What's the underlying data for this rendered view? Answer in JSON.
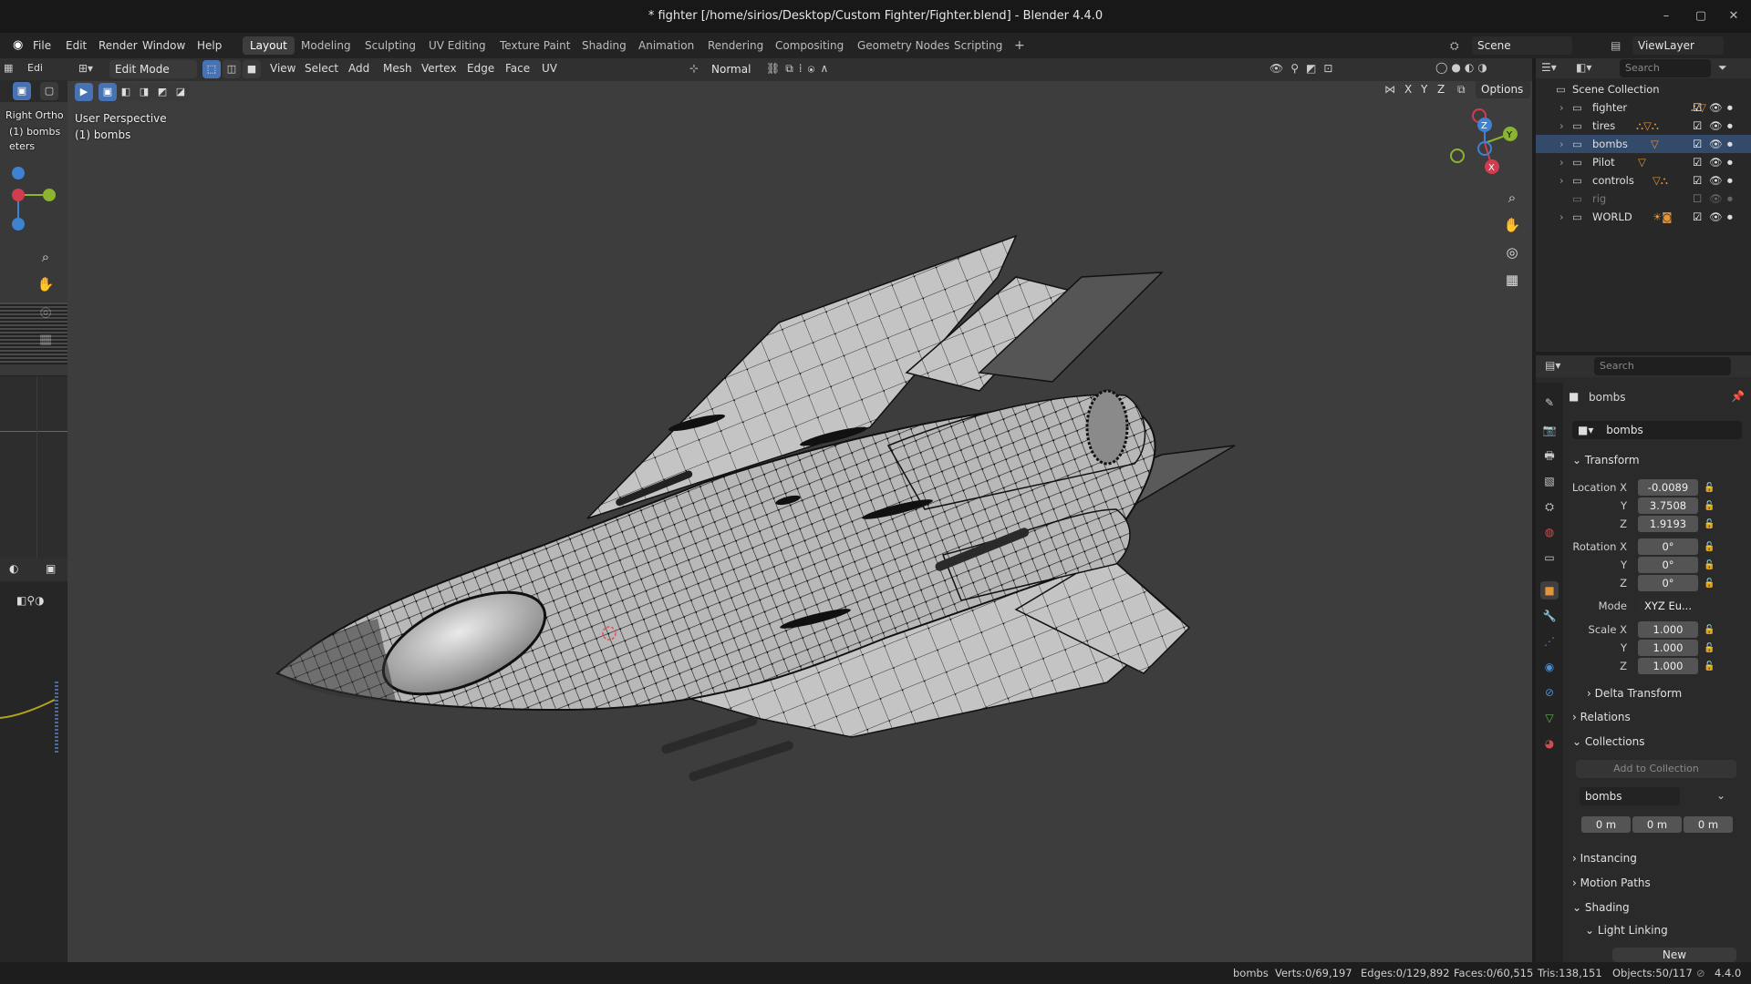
{
  "window": {
    "title": "* fighter [/home/sirios/Desktop/Custom Fighter/Fighter.blend] - Blender 4.4.0",
    "minimize": "–",
    "maximize": "▢",
    "close": "✕"
  },
  "menu": [
    "File",
    "Edit",
    "Render",
    "Window",
    "Help"
  ],
  "workspaces": [
    {
      "label": "Layout",
      "active": true
    },
    {
      "label": "Modeling"
    },
    {
      "label": "Sculpting"
    },
    {
      "label": "UV Editing"
    },
    {
      "label": "Texture Paint"
    },
    {
      "label": "Shading"
    },
    {
      "label": "Animation"
    },
    {
      "label": "Rendering"
    },
    {
      "label": "Compositing"
    },
    {
      "label": "Geometry Nodes"
    },
    {
      "label": "Scripting"
    }
  ],
  "add_workspace": "+",
  "scene": {
    "label": "Scene",
    "viewlayer": "ViewLayer"
  },
  "left_editor": {
    "mode": "Edi",
    "view_name": "Right Ortho",
    "object": "(1) bombs",
    "extra": "eters"
  },
  "viewport_header": {
    "mode": "Edit Mode",
    "menus": [
      "View",
      "Select",
      "Add",
      "Mesh",
      "Vertex",
      "Edge",
      "Face",
      "UV"
    ],
    "orientation": "Normal",
    "options": "Options",
    "axes": [
      "X",
      "Y",
      "Z"
    ]
  },
  "viewport": {
    "view_name": "User Perspective",
    "object": "(1) bombs",
    "gizmo": {
      "x": "X",
      "y": "Y",
      "z": "Z"
    }
  },
  "outliner": {
    "search_placeholder": "Search",
    "root": "Scene Collection",
    "items": [
      {
        "name": "fighter",
        "checked": true,
        "visible": true
      },
      {
        "name": "tires",
        "checked": true,
        "visible": true
      },
      {
        "name": "bombs",
        "checked": true,
        "visible": true,
        "selected": true
      },
      {
        "name": "Pilot",
        "checked": true,
        "visible": true
      },
      {
        "name": "controls",
        "checked": true,
        "visible": true
      },
      {
        "name": "rig",
        "checked": false,
        "visible": false
      },
      {
        "name": "WORLD",
        "checked": true,
        "visible": true
      }
    ]
  },
  "properties": {
    "search_placeholder": "Search",
    "object_name": "bombs",
    "datablock": "bombs",
    "transform_title": "Transform",
    "location": {
      "label": "Location X",
      "x": "-0.0089",
      "y": "3.7508",
      "z": "1.9193"
    },
    "rotation": {
      "label": "Rotation X",
      "x": "0°",
      "y": "0°",
      "z": "0°"
    },
    "mode": {
      "label": "Mode",
      "value": "XYZ Eu..."
    },
    "scale": {
      "label": "Scale X",
      "x": "1.000",
      "y": "1.000",
      "z": "1.000"
    },
    "axis_y": "Y",
    "axis_z": "Z",
    "delta": "Delta Transform",
    "relations": "Relations",
    "collections": "Collections",
    "add_to_collection": "Add to Collection",
    "collection_name": "bombs",
    "offsets": [
      "0 m",
      "0 m",
      "0 m"
    ],
    "instancing": "Instancing",
    "motion_paths": "Motion Paths",
    "shading": "Shading",
    "light_linking": "Light Linking",
    "new": "New"
  },
  "status": {
    "object": "bombs",
    "verts": "Verts:0/69,197",
    "edges": "Edges:0/129,892",
    "faces": "Faces:0/60,515",
    "tris": "Tris:138,151",
    "objects": "Objects:50/117",
    "version": "4.4.0"
  },
  "colors": {
    "accent": "#4772b3",
    "axis_x": "#d13d4f",
    "axis_y": "#8bb42f",
    "axis_z": "#3d83d1",
    "orange": "#e0953a"
  }
}
